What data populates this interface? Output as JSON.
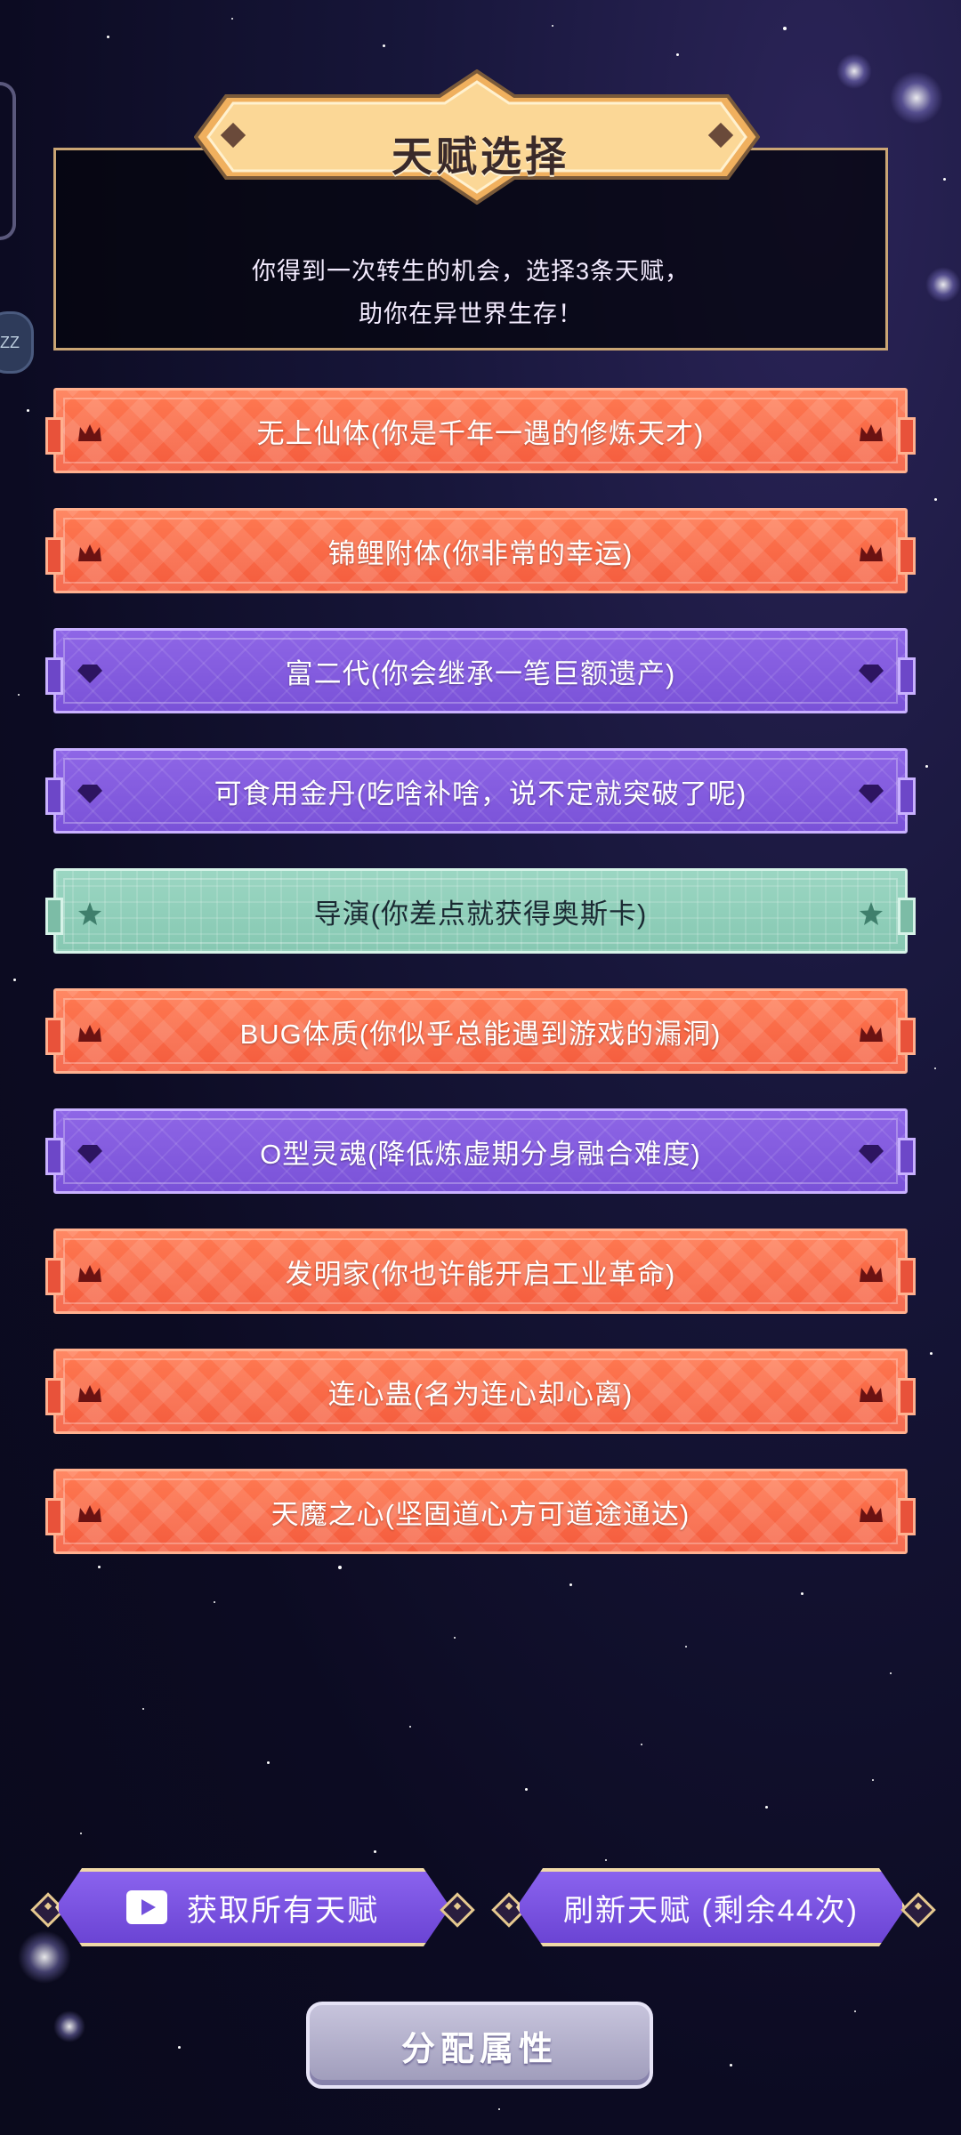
{
  "title": "天赋选择",
  "intro": {
    "line1": "你得到一次转生的机会，选择3条天赋，",
    "line2": "助你在异世界生存！"
  },
  "side_badge": "ZZ",
  "talents": [
    {
      "label": "无上仙体(你是千年一遇的修炼天才)",
      "tier": "orange",
      "icon": "crown-icon"
    },
    {
      "label": "锦鲤附体(你非常的幸运)",
      "tier": "orange",
      "icon": "crown-icon"
    },
    {
      "label": "富二代(你会继承一笔巨额遗产)",
      "tier": "purple",
      "icon": "diamond-gem-icon"
    },
    {
      "label": "可食用金丹(吃啥补啥，说不定就突破了呢)",
      "tier": "purple",
      "icon": "diamond-gem-icon"
    },
    {
      "label": "导演(你差点就获得奥斯卡)",
      "tier": "teal",
      "icon": "star-icon"
    },
    {
      "label": "BUG体质(你似乎总能遇到游戏的漏洞)",
      "tier": "orange",
      "icon": "crown-icon"
    },
    {
      "label": "O型灵魂(降低炼虚期分身融合难度)",
      "tier": "purple",
      "icon": "diamond-gem-icon"
    },
    {
      "label": "发明家(你也许能开启工业革命)",
      "tier": "orange",
      "icon": "crown-icon"
    },
    {
      "label": "连心蛊(名为连心却心离)",
      "tier": "orange",
      "icon": "crown-icon"
    },
    {
      "label": "天魔之心(坚固道心方可道途通达)",
      "tier": "orange",
      "icon": "crown-icon"
    }
  ],
  "buttons": {
    "get_all": "获取所有天赋",
    "refresh": "刷新天赋 (剩余44次)",
    "allocate": "分配属性"
  },
  "colors": {
    "orange": "#f45b3d",
    "purple": "#7a52d8",
    "teal": "#86c8b2",
    "gold_border": "#caa574"
  }
}
